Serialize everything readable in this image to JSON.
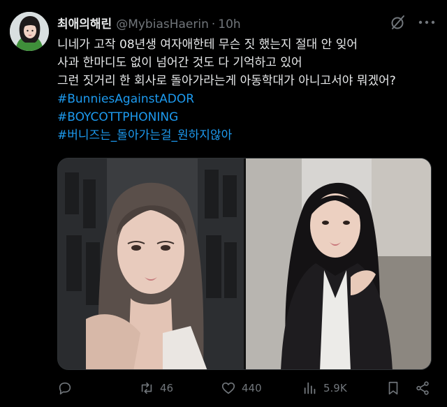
{
  "tweet": {
    "display_name": "최애의해린",
    "handle": "@MybiasHaerin",
    "separator": "·",
    "time": "10h",
    "lines": [
      "니네가 고작 08년생 여자애한테 무슨 짓 했는지 절대 안 잊어",
      "사과 한마디도 없이 넘어간 것도 다 기억하고 있어",
      "그런 짓거리 한 회사로 돌아가라는게 아동학대가 아니고서야 뭐겠어?"
    ],
    "hashtags": [
      "#BunniesAgainstADOR",
      "#BOYCOTTPHONING",
      "#버니즈는_돌아가는걸_원하지않아"
    ],
    "media": [
      {
        "icon": "photo"
      },
      {
        "icon": "photo"
      }
    ]
  },
  "actions": {
    "reply": {
      "icon": "reply-icon",
      "count": ""
    },
    "retweet": {
      "icon": "retweet-icon",
      "count": "46"
    },
    "like": {
      "icon": "heart-icon",
      "count": "440"
    },
    "views": {
      "icon": "views-icon",
      "count": "5.9K"
    },
    "bookmark": {
      "icon": "bookmark-icon",
      "count": ""
    },
    "share": {
      "icon": "share-icon",
      "count": ""
    }
  },
  "colors": {
    "background": "#000000",
    "text": "#e7e9ea",
    "muted": "#71767b",
    "link": "#1d9bf0"
  }
}
